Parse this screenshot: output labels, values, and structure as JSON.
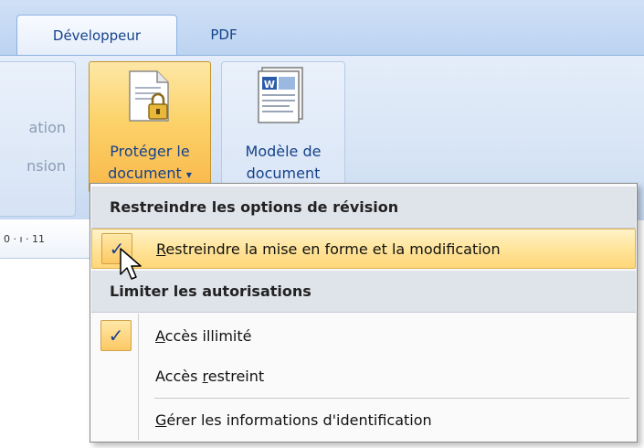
{
  "tabs": [
    {
      "label": "Développeur",
      "active": true
    },
    {
      "label": "PDF",
      "active": false
    }
  ],
  "left_group": {
    "line1": "ation",
    "line2": "nsion"
  },
  "protect_button": {
    "line1": "Protéger le",
    "line2": "document",
    "arrow": "▾"
  },
  "modele_button": {
    "line1": "Modèle de",
    "line2": "document"
  },
  "ruler": {
    "text": "0 · ı · 11"
  },
  "menu": {
    "header1": "Restreindre les options de révision",
    "item_restrict": {
      "mnemonic": "R",
      "rest": "estreindre la mise en forme et la modification",
      "checked": true
    },
    "header2": "Limiter les autorisations",
    "item_unlimited": {
      "mnemonic": "A",
      "rest": "ccès illimité",
      "checked": true
    },
    "item_restricted": {
      "before": "Accès ",
      "mnemonic": "r",
      "after": "estreint"
    },
    "item_manage": {
      "mnemonic": "G",
      "rest": "érer les informations d'identification"
    },
    "check_glyph": "✓"
  },
  "colors": {
    "accent_text": "#15428b",
    "highlight": "#ffe49a",
    "ribbon": "#d7e4f5"
  }
}
